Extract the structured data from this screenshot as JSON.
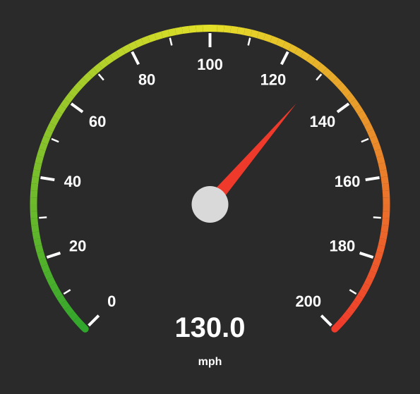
{
  "chart_data": {
    "type": "gauge",
    "min": 0,
    "max": 200,
    "value": 130.0,
    "major_step": 20,
    "minor_step": 10,
    "unit": "mph",
    "readout": "130.0",
    "start_angle": 225,
    "end_angle": -45,
    "ticks": [
      0,
      20,
      40,
      60,
      80,
      100,
      120,
      140,
      160,
      180,
      200
    ],
    "labels": [
      "0",
      "20",
      "40",
      "60",
      "80",
      "100",
      "120",
      "140",
      "160",
      "180",
      "200"
    ],
    "arc_colors": {
      "start": "#2fa62c",
      "mid": "#e4e029",
      "end": "#ef3a2b"
    }
  }
}
